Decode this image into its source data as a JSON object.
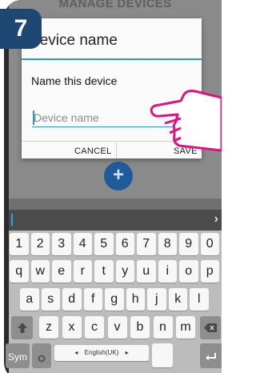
{
  "step_badge": "7",
  "background_screen": {
    "title": "MANAGE DEVICES",
    "fab_symbol": "+"
  },
  "dialog": {
    "title": "Device name",
    "prompt": "Name this device",
    "input": {
      "value": "",
      "placeholder": "Device name"
    },
    "cancel_label": "CANCEL",
    "save_label": "SAVE"
  },
  "keyboard": {
    "expand_arrow": "›",
    "row_numbers": [
      "1",
      "2",
      "3",
      "4",
      "5",
      "6",
      "7",
      "8",
      "9",
      "0"
    ],
    "row_top": [
      "q",
      "w",
      "e",
      "r",
      "t",
      "y",
      "u",
      "i",
      "o",
      "p"
    ],
    "row_middle": [
      "a",
      "s",
      "d",
      "f",
      "g",
      "h",
      "j",
      "k",
      "l"
    ],
    "row_bottom": [
      "z",
      "x",
      "c",
      "v",
      "b",
      "n",
      "m"
    ],
    "shift_icon": "shift-icon",
    "backspace_icon": "backspace-icon",
    "sym_label": "Sym",
    "language_label": "English(UK)",
    "language_prev": "◂",
    "language_next": "▸",
    "enter_icon": "enter-icon"
  },
  "colors": {
    "badge": "#1f4773",
    "accent": "#2a9bd0",
    "hand_outline": "#e0127e"
  }
}
